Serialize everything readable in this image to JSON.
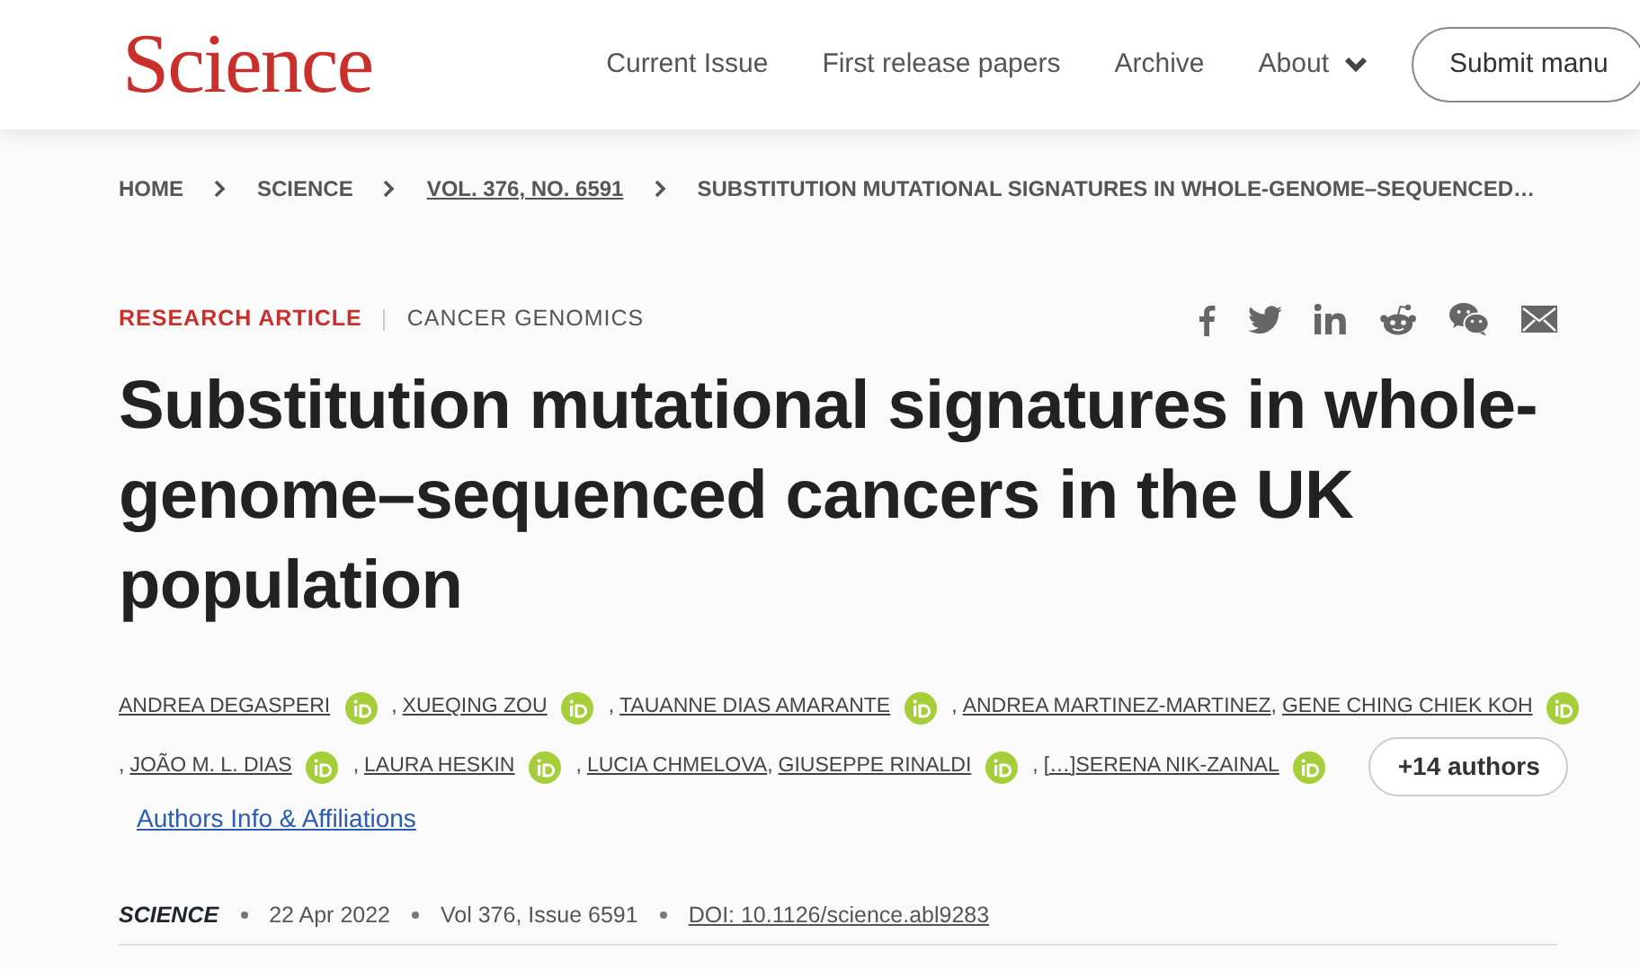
{
  "header": {
    "logo": "Science",
    "nav": [
      {
        "label": "Current Issue",
        "caret": false
      },
      {
        "label": "First release papers",
        "caret": false
      },
      {
        "label": "Archive",
        "caret": false
      },
      {
        "label": "About",
        "caret": true
      }
    ],
    "submit": "Submit manu"
  },
  "breadcrumb": [
    {
      "label": "HOME",
      "link": false
    },
    {
      "label": "SCIENCE",
      "link": false
    },
    {
      "label": "VOL. 376, NO. 6591",
      "link": true
    },
    {
      "label": "SUBSTITUTION MUTATIONAL SIGNATURES IN WHOLE-GENOME–SEQUENCED…",
      "link": false
    }
  ],
  "article": {
    "type": "RESEARCH ARTICLE",
    "topic": "CANCER GENOMICS",
    "title": "Substitution mutational signatures in whole-genome–sequenced cancers in the UK population",
    "author_lines": [
      [
        {
          "kind": "author",
          "name": "ANDREA DEGASPERI",
          "orcid": true
        },
        {
          "kind": "sep",
          "text": ","
        },
        {
          "kind": "author",
          "name": "XUEQING ZOU",
          "orcid": true
        },
        {
          "kind": "sep",
          "text": ","
        },
        {
          "kind": "author",
          "name": "TAUANNE DIAS AMARANTE",
          "orcid": true
        },
        {
          "kind": "sep",
          "text": ","
        },
        {
          "kind": "author",
          "name": "ANDREA MARTINEZ-MARTINEZ",
          "orcid": false
        },
        {
          "kind": "sep",
          "text": ","
        },
        {
          "kind": "author",
          "name": "GENE CHING CHIEK KOH",
          "orcid": true
        }
      ],
      [
        {
          "kind": "sep",
          "text": ","
        },
        {
          "kind": "author",
          "name": "JOÃO M. L. DIAS",
          "orcid": true
        },
        {
          "kind": "sep",
          "text": ","
        },
        {
          "kind": "author",
          "name": "LAURA HESKIN",
          "orcid": true
        },
        {
          "kind": "sep",
          "text": ","
        },
        {
          "kind": "author",
          "name": "LUCIA CHMELOVA",
          "orcid": false
        },
        {
          "kind": "sep",
          "text": ","
        },
        {
          "kind": "author",
          "name": "GIUSEPPE RINALDI",
          "orcid": true
        },
        {
          "kind": "sep",
          "text": ","
        },
        {
          "kind": "author",
          "name": "[…]",
          "orcid": false
        },
        {
          "kind": "author",
          "name": "SERENA NIK-ZAINAL",
          "orcid": true
        },
        {
          "kind": "more",
          "text": "+14 authors"
        }
      ]
    ],
    "affiliations": "Authors Info & Affiliations",
    "meta": {
      "journal": "SCIENCE",
      "date": "22 Apr 2022",
      "volume": "Vol 376, Issue 6591",
      "doi": "DOI: 10.1126/science.abl9283"
    }
  }
}
